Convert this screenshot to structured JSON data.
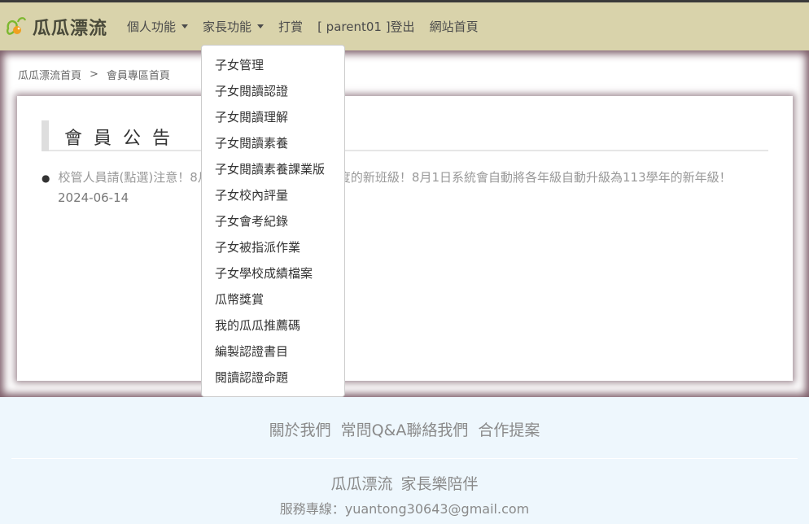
{
  "brand": {
    "name": "瓜瓜漂流"
  },
  "nav": {
    "personal": "個人功能",
    "parent": "家長功能",
    "typing": "打賞",
    "logout": "[ parent01 ]登出",
    "site_home": "網站首頁"
  },
  "breadcrumb": {
    "home": "瓜瓜漂流首頁",
    "separator": ">",
    "current": "會員專區首頁"
  },
  "announcement": {
    "title": "會員公告",
    "items": [
      {
        "text": "校管人員請(點選)注意！8月1日前請勿新增113學年度的新班級！8月1日系統會自動將各年級自動升級為113學年的新年級！",
        "date": "2024-06-14"
      }
    ]
  },
  "parent_menu": {
    "items": [
      "子女管理",
      "子女閱讀認證",
      "子女閱讀理解",
      "子女閱讀素養",
      "子女閱讀素養課業版",
      "子女校內評量",
      "子女會考紀錄",
      "子女被指派作業",
      "子女學校成績檔案",
      "瓜幣獎賞",
      "我的瓜瓜推薦碼",
      "編製認證書目",
      "閱讀認證命題"
    ]
  },
  "footer": {
    "about": "關於我們",
    "faq": "常問Q&A",
    "contact": "聯絡我們",
    "cooperation": "合作提案",
    "brand": "瓜瓜漂流",
    "slogan": "家長樂陪伴",
    "service": "服務專線：yuantong30643@gmail.com"
  },
  "colors": {
    "navbar": "#d9d3ab",
    "footer": "#eef7fd",
    "logo_green": "#7cb82f",
    "logo_orange": "#f0a020"
  }
}
